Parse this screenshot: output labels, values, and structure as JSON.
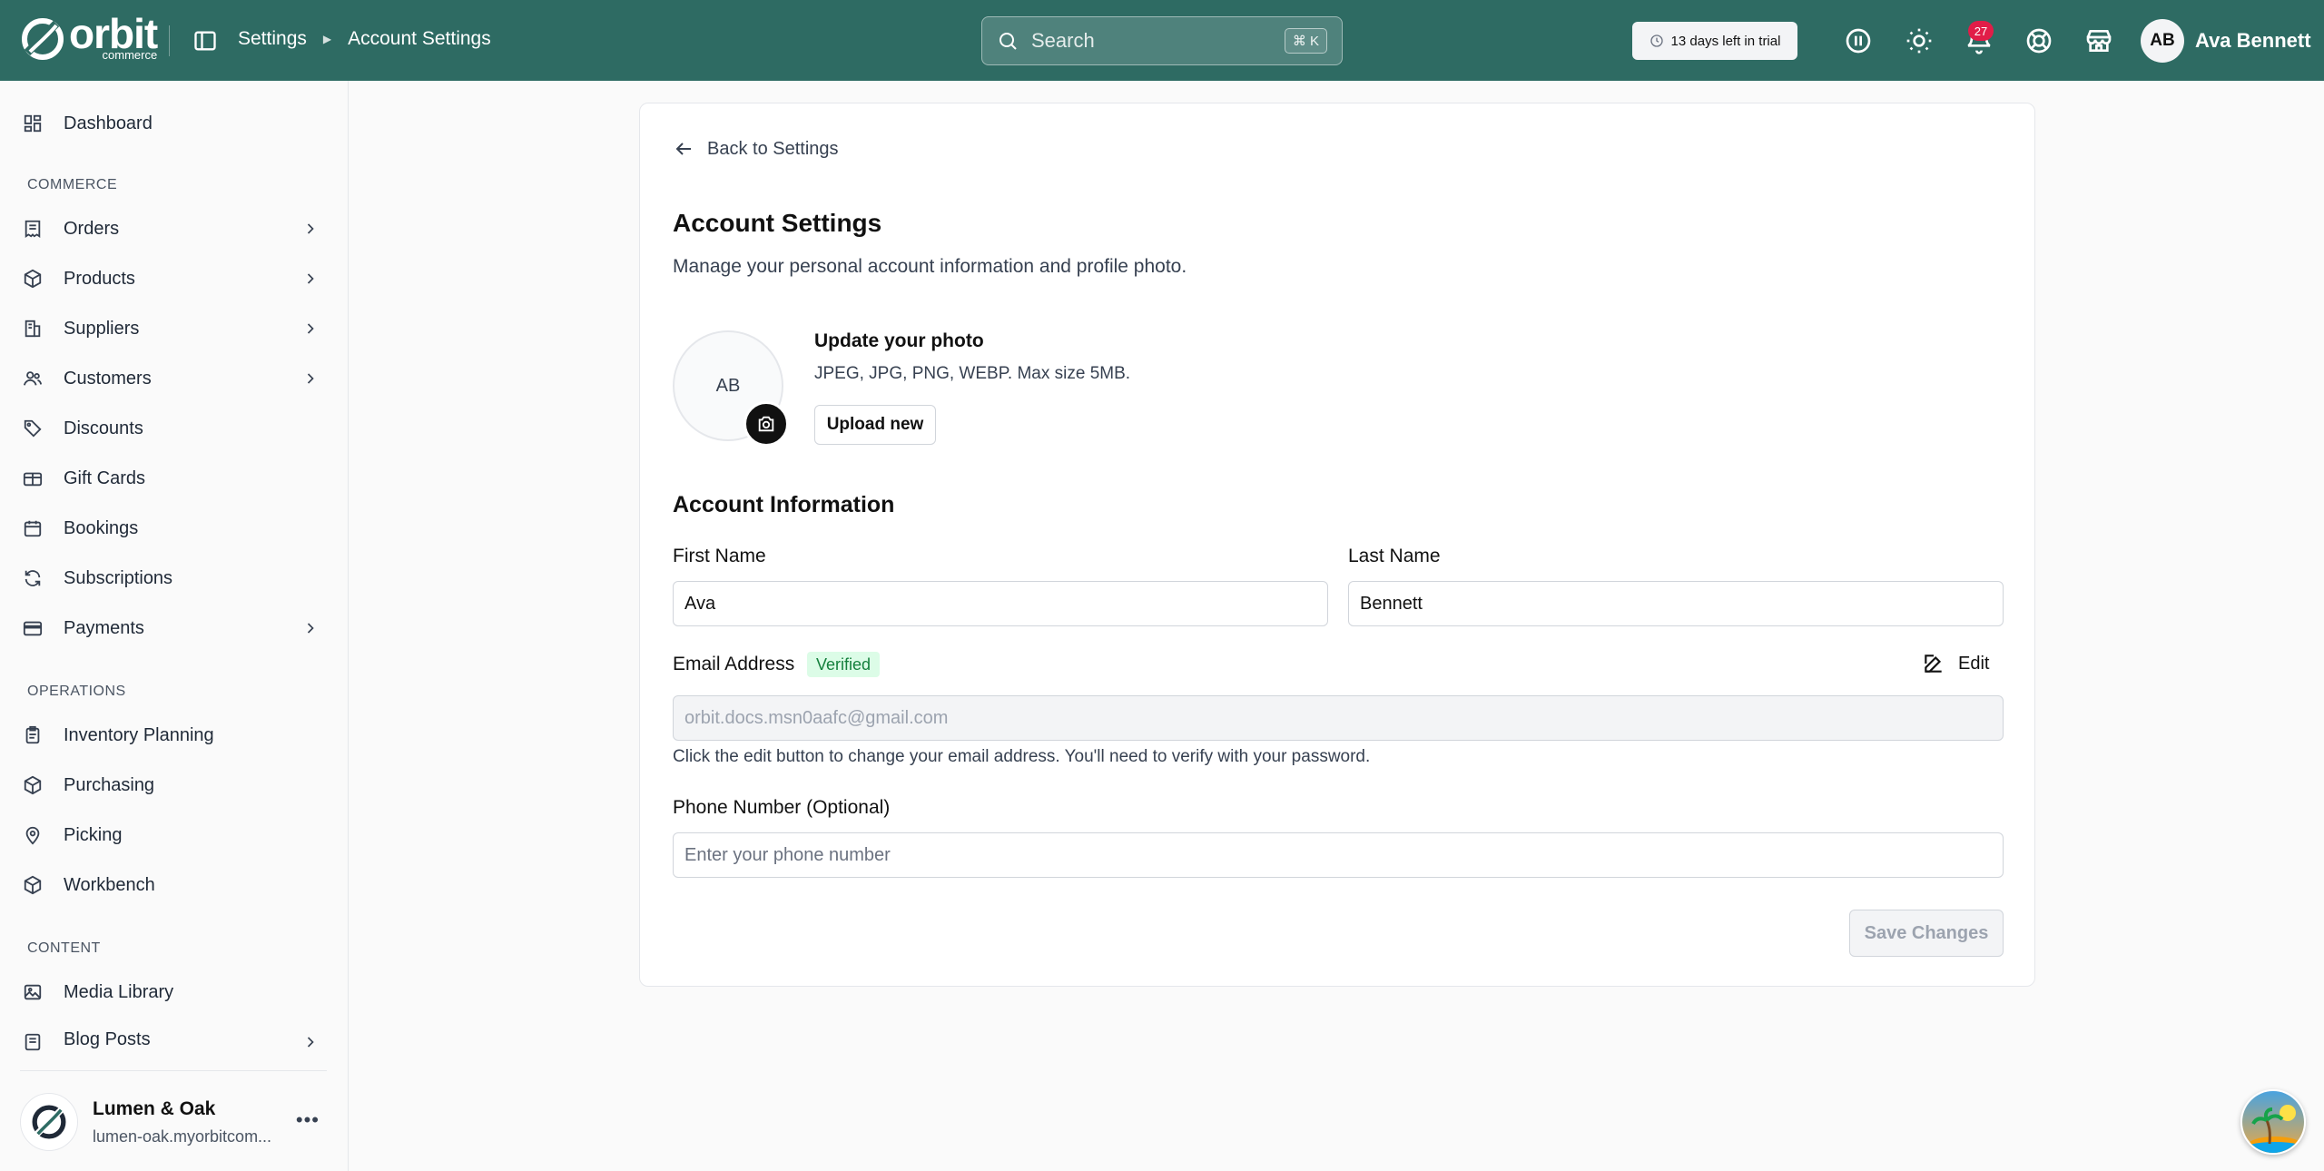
{
  "brand": {
    "word": "orbit",
    "sub": "commerce"
  },
  "breadcrumb": {
    "parent": "Settings",
    "current": "Account Settings"
  },
  "search": {
    "placeholder": "Search",
    "shortcut": "⌘ K"
  },
  "trial": {
    "text": "13 days left in trial"
  },
  "notifications": {
    "count": "27"
  },
  "user": {
    "initials": "AB",
    "name": "Ava Bennett"
  },
  "sidebar": {
    "dashboard": "Dashboard",
    "sections": {
      "commerce": "COMMERCE",
      "operations": "OPERATIONS",
      "content": "CONTENT"
    },
    "commerce_items": [
      "Orders",
      "Products",
      "Suppliers",
      "Customers",
      "Discounts",
      "Gift Cards",
      "Bookings",
      "Subscriptions",
      "Payments"
    ],
    "operations_items": [
      "Inventory Planning",
      "Purchasing",
      "Picking",
      "Workbench"
    ],
    "content_items": [
      "Media Library",
      "Blog Posts"
    ],
    "store": {
      "name": "Lumen & Oak",
      "url": "lumen-oak.myorbitcom..."
    }
  },
  "main": {
    "back": "Back to Settings",
    "title": "Account Settings",
    "description": "Manage your personal account information and profile photo.",
    "photo": {
      "initials": "AB",
      "title": "Update your photo",
      "hint": "JPEG, JPG, PNG, WEBP. Max size 5MB.",
      "upload_label": "Upload new"
    },
    "section_title": "Account Information",
    "first_name": {
      "label": "First Name",
      "value": "Ava"
    },
    "last_name": {
      "label": "Last Name",
      "value": "Bennett"
    },
    "email": {
      "label": "Email Address",
      "badge": "Verified",
      "edit_label": "Edit",
      "value": "orbit.docs.msn0aafc@gmail.com",
      "help": "Click the edit button to change your email address. You'll need to verify with your password."
    },
    "phone": {
      "label": "Phone Number (Optional)",
      "placeholder": "Enter your phone number"
    },
    "save_label": "Save Changes"
  },
  "colors": {
    "header": "#2e6b63",
    "badge": "#e11d48",
    "verified_bg": "#dcfce7",
    "verified_text": "#15803d"
  }
}
